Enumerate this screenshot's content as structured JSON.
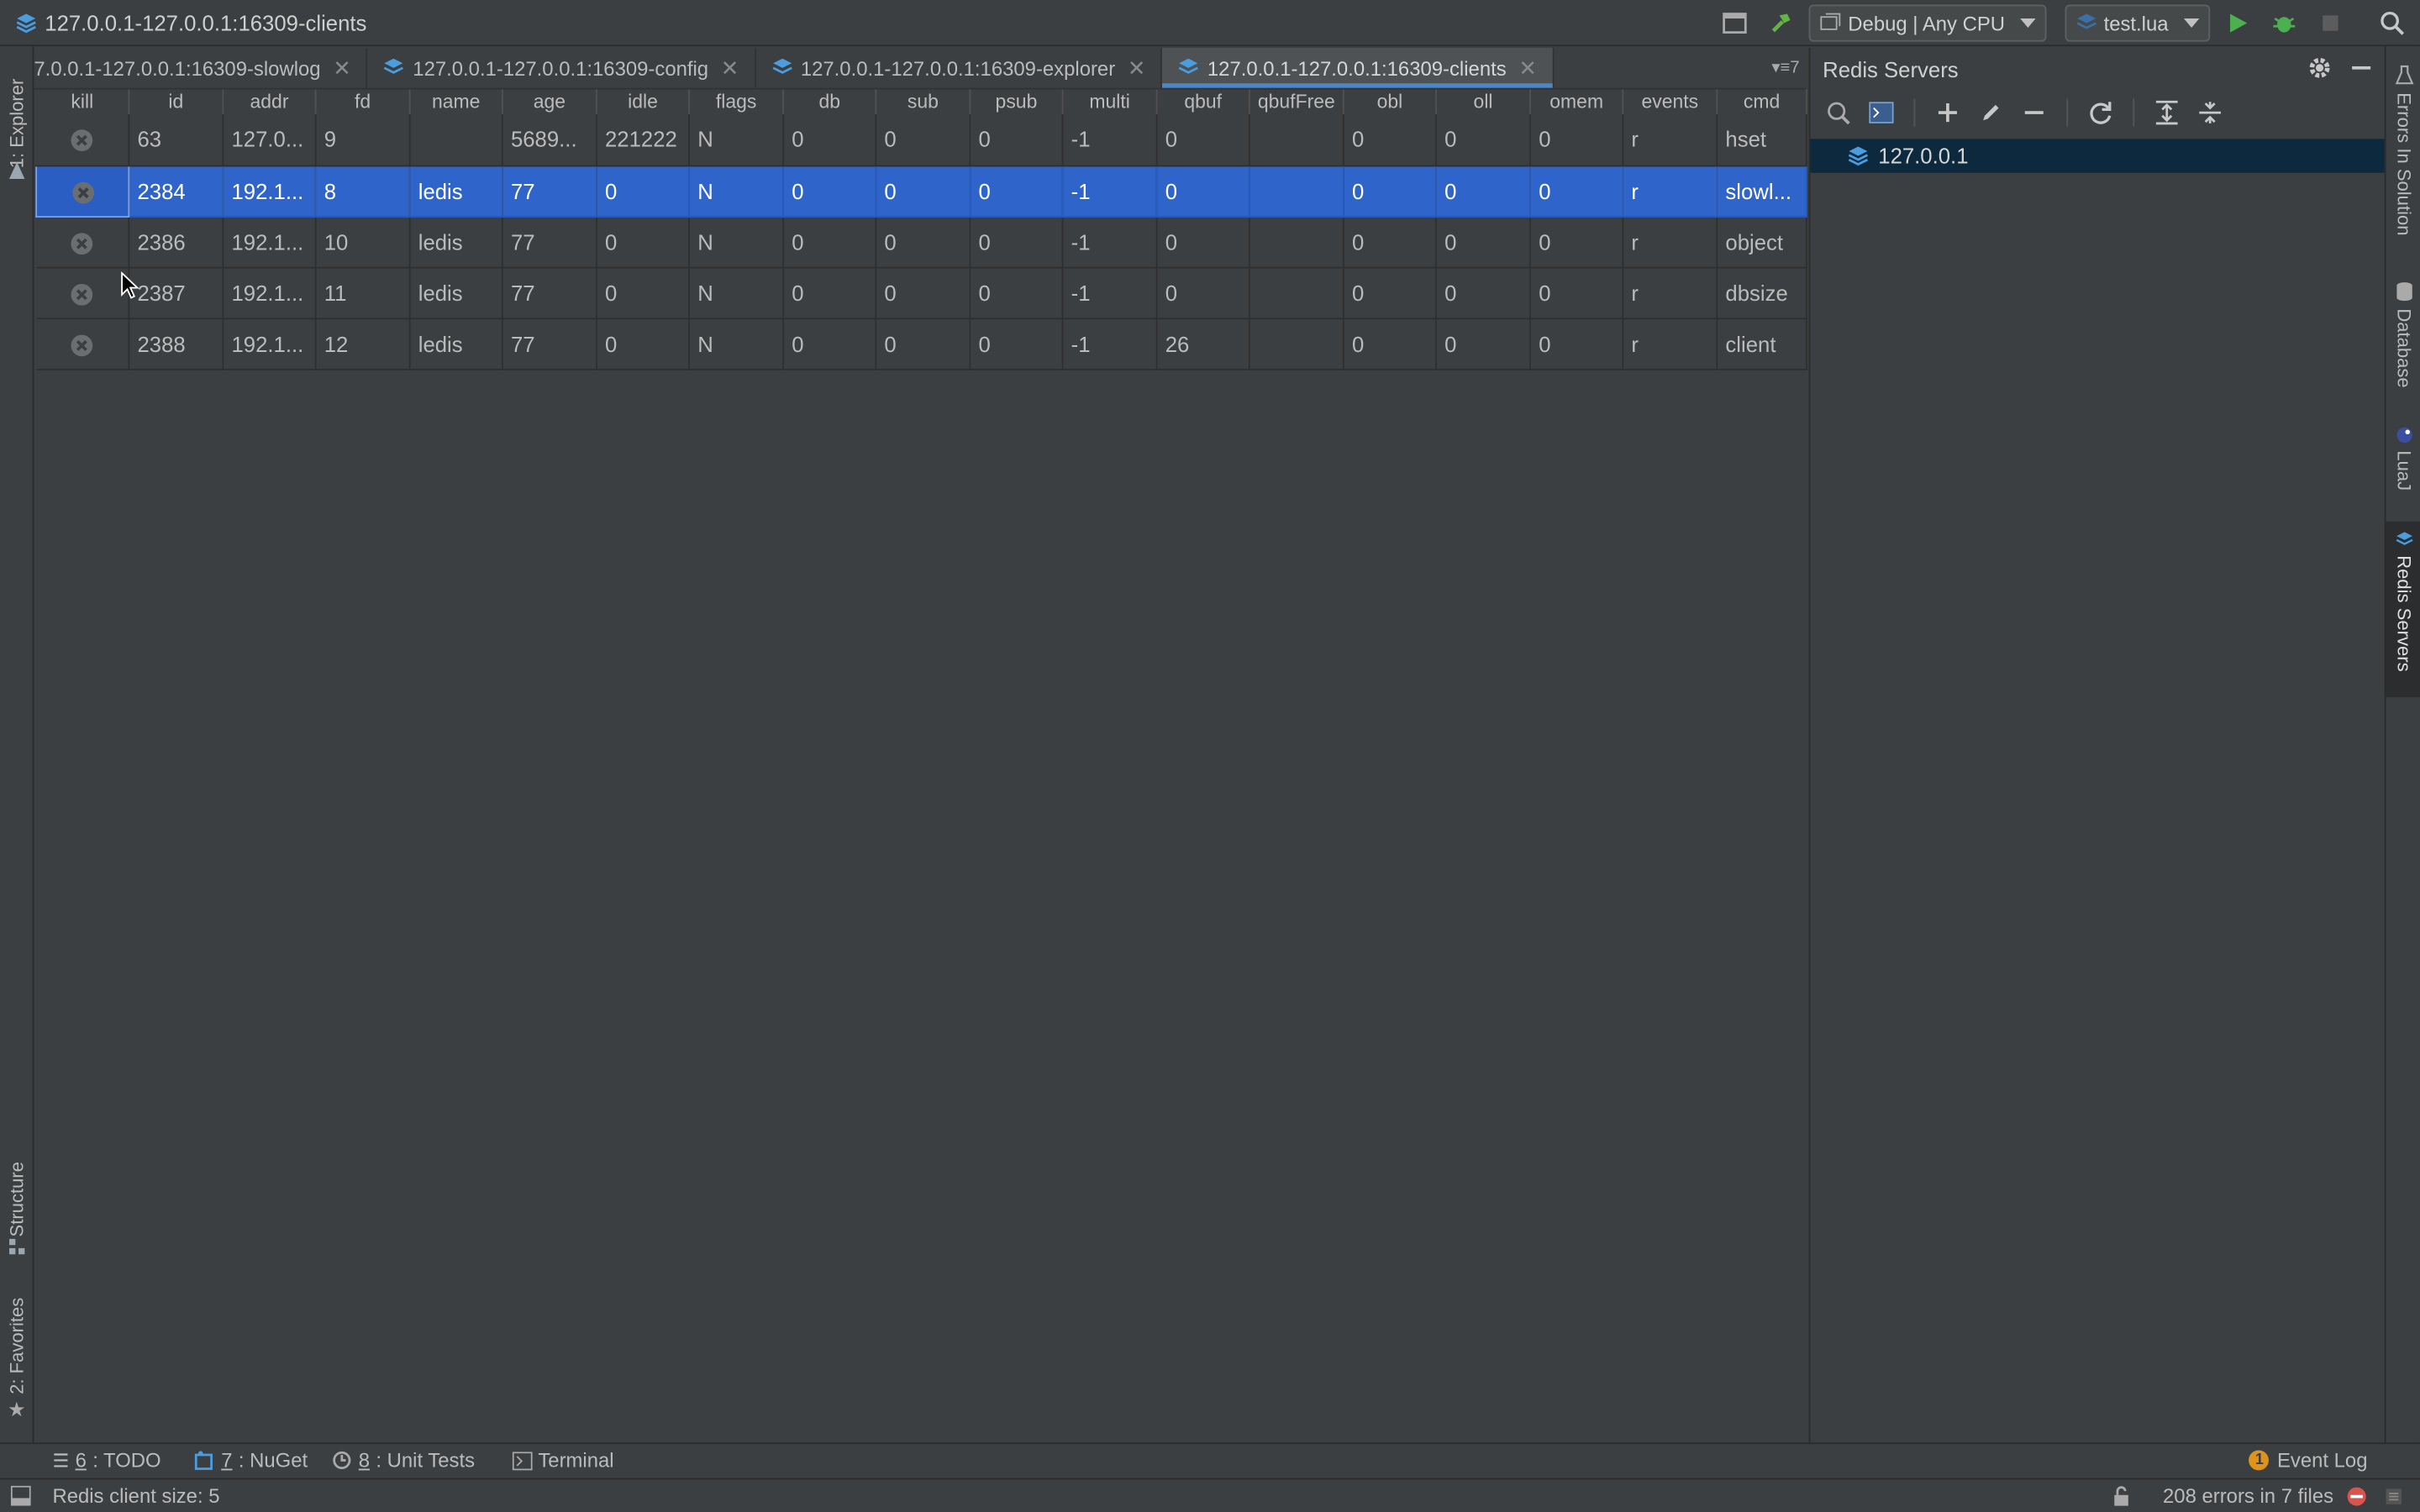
{
  "window": {
    "title": "127.0.0.1-127.0.0.1:16309-clients"
  },
  "toolbar": {
    "config_label": "Debug | Any CPU",
    "run_config_label": "test.lua"
  },
  "left_tools": {
    "explorer": "1: Explorer",
    "structure": "Structure",
    "favorites": "2: Favorites"
  },
  "tabs": [
    {
      "label": "7.0.0.1-127.0.0.1:16309-slowlog",
      "active": false
    },
    {
      "label": "127.0.0.1-127.0.0.1:16309-config",
      "active": false
    },
    {
      "label": "127.0.0.1-127.0.0.1:16309-explorer",
      "active": false
    },
    {
      "label": "127.0.0.1-127.0.0.1:16309-clients",
      "active": true
    }
  ],
  "tabs_more": "7",
  "clients_table": {
    "columns": [
      "kill",
      "id",
      "addr",
      "fd",
      "name",
      "age",
      "idle",
      "flags",
      "db",
      "sub",
      "psub",
      "multi",
      "qbuf",
      "qbufFree",
      "obl",
      "oll",
      "omem",
      "events",
      "cmd"
    ],
    "rows": [
      {
        "selected": false,
        "cells": [
          "",
          "63",
          "127.0...",
          "9",
          "",
          "5689...",
          "221222",
          "N",
          "0",
          "0",
          "0",
          "-1",
          "0",
          "",
          "0",
          "0",
          "0",
          "r",
          "hset"
        ]
      },
      {
        "selected": true,
        "cells": [
          "",
          "2384",
          "192.1...",
          "8",
          "ledis",
          "77",
          "0",
          "N",
          "0",
          "0",
          "0",
          "-1",
          "0",
          "",
          "0",
          "0",
          "0",
          "r",
          "slowl..."
        ]
      },
      {
        "selected": false,
        "cells": [
          "",
          "2386",
          "192.1...",
          "10",
          "ledis",
          "77",
          "0",
          "N",
          "0",
          "0",
          "0",
          "-1",
          "0",
          "",
          "0",
          "0",
          "0",
          "r",
          "object"
        ]
      },
      {
        "selected": false,
        "cells": [
          "",
          "2387",
          "192.1...",
          "11",
          "ledis",
          "77",
          "0",
          "N",
          "0",
          "0",
          "0",
          "-1",
          "0",
          "",
          "0",
          "0",
          "0",
          "r",
          "dbsize"
        ]
      },
      {
        "selected": false,
        "cells": [
          "",
          "2388",
          "192.1...",
          "12",
          "ledis",
          "77",
          "0",
          "N",
          "0",
          "0",
          "0",
          "-1",
          "26",
          "",
          "0",
          "0",
          "0",
          "r",
          "client"
        ]
      }
    ]
  },
  "redis_panel": {
    "title": "Redis Servers",
    "servers": [
      {
        "label": "127.0.0.1",
        "selected": true
      }
    ]
  },
  "right_tools": {
    "errors": "Errors In Solution",
    "database": "Database",
    "lua": "LuaJ",
    "redis": "Redis Servers"
  },
  "bottom_tools": [
    {
      "num": "6",
      "label": ": TODO"
    },
    {
      "num": "7",
      "label": ": NuGet"
    },
    {
      "num": "8",
      "label": ": Unit Tests"
    },
    {
      "num": "",
      "label": "Terminal"
    }
  ],
  "event_log": {
    "label": "Event Log",
    "count": "1"
  },
  "status": {
    "message": "Redis client size: 5",
    "errors": "208 errors in 7 files"
  },
  "colors": {
    "accent": "#4a88c7",
    "selection": "#2f65ca",
    "background": "#3c3f41",
    "run": "#4caf50"
  }
}
